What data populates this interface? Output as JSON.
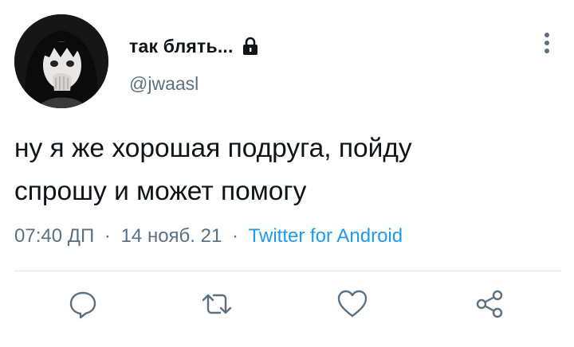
{
  "user": {
    "display_name": "так блять...",
    "handle": "@jwaasl",
    "protected": true,
    "avatar": "anime-girl-avatar"
  },
  "tweet": {
    "text_lines": [
      "ну я же хорошая подруга, пойду",
      "спрошу и может помогу"
    ],
    "time": "07:40 ДП",
    "date": "14 нояб. 21",
    "separator": "·",
    "source": "Twitter for Android"
  },
  "actions": {
    "reply_icon": "reply-icon",
    "retweet_icon": "retweet-icon",
    "like_icon": "heart-icon",
    "share_icon": "share-icon",
    "more_icon": "more-vertical-icon"
  },
  "colors": {
    "text": "#0f1419",
    "secondary": "#5b7083",
    "link": "#1d9bf0",
    "divider": "#e1e8ed",
    "icon": "#5b7083"
  }
}
